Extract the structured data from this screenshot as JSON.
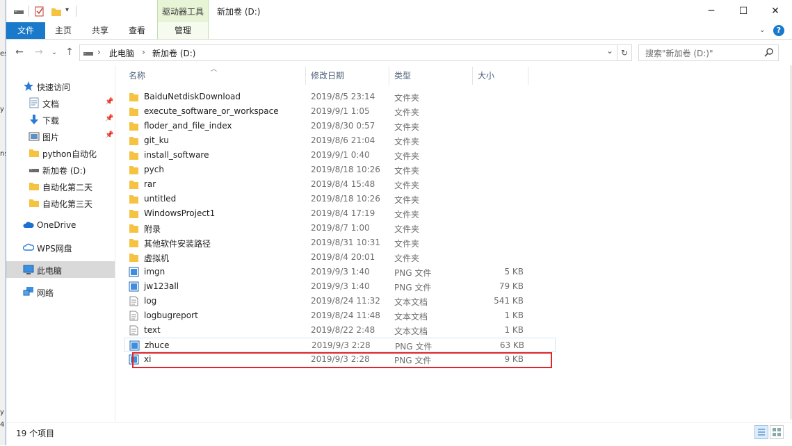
{
  "window": {
    "title": "新加卷 (D:)",
    "context_group": "驱动器工具",
    "controls": {
      "minimize": "─",
      "maximize": "☐",
      "close": "✕"
    }
  },
  "ribbon": {
    "tabs": [
      "文件",
      "主页",
      "共享",
      "查看",
      "管理"
    ],
    "help": "?"
  },
  "address": {
    "back": "←",
    "forward": "→",
    "up": "↑",
    "crumbs": [
      "此电脑",
      "新加卷 (D:)"
    ],
    "separator": "›",
    "dropdown": "⌄",
    "refresh": "↻"
  },
  "search": {
    "placeholder": "搜索\"新加卷 (D:)\"",
    "icon": "search-icon"
  },
  "sidebar": {
    "items": [
      {
        "label": "快速访问",
        "icon": "star-icon",
        "pinned": false
      },
      {
        "label": "文档",
        "icon": "document-icon",
        "pinned": true
      },
      {
        "label": "下载",
        "icon": "download-icon",
        "pinned": true
      },
      {
        "label": "图片",
        "icon": "picture-icon",
        "pinned": true
      },
      {
        "label": "python自动化",
        "icon": "folder-icon",
        "pinned": false
      },
      {
        "label": "新加卷 (D:)",
        "icon": "drive-icon",
        "pinned": false
      },
      {
        "label": "自动化第二天",
        "icon": "folder-icon",
        "pinned": false
      },
      {
        "label": "自动化第三天",
        "icon": "folder-icon",
        "pinned": false
      },
      {
        "label": "OneDrive",
        "icon": "cloud-icon",
        "pinned": false
      },
      {
        "label": "WPS网盘",
        "icon": "cloud-outline-icon",
        "pinned": false
      },
      {
        "label": "此电脑",
        "icon": "computer-icon",
        "pinned": false,
        "selected": true
      },
      {
        "label": "网络",
        "icon": "network-icon",
        "pinned": false
      }
    ]
  },
  "columns": {
    "name": "名称",
    "date": "修改日期",
    "type": "类型",
    "size": "大小"
  },
  "files": [
    {
      "name": "BaiduNetdiskDownload",
      "date": "2019/8/5 23:14",
      "type": "文件夹",
      "size": "",
      "kind": "folder"
    },
    {
      "name": "execute_software_or_workspace",
      "date": "2019/9/1 1:05",
      "type": "文件夹",
      "size": "",
      "kind": "folder"
    },
    {
      "name": "floder_and_file_index",
      "date": "2019/8/30 0:57",
      "type": "文件夹",
      "size": "",
      "kind": "folder"
    },
    {
      "name": "git_ku",
      "date": "2019/8/6 21:04",
      "type": "文件夹",
      "size": "",
      "kind": "folder"
    },
    {
      "name": "install_software",
      "date": "2019/9/1 0:40",
      "type": "文件夹",
      "size": "",
      "kind": "folder"
    },
    {
      "name": "pych",
      "date": "2019/8/18 10:26",
      "type": "文件夹",
      "size": "",
      "kind": "folder"
    },
    {
      "name": "rar",
      "date": "2019/8/4 15:48",
      "type": "文件夹",
      "size": "",
      "kind": "folder"
    },
    {
      "name": "untitled",
      "date": "2019/8/18 10:26",
      "type": "文件夹",
      "size": "",
      "kind": "folder"
    },
    {
      "name": "WindowsProject1",
      "date": "2019/8/4 17:19",
      "type": "文件夹",
      "size": "",
      "kind": "folder"
    },
    {
      "name": "附录",
      "date": "2019/8/7 1:00",
      "type": "文件夹",
      "size": "",
      "kind": "folder"
    },
    {
      "name": "其他软件安装路径",
      "date": "2019/8/31 10:31",
      "type": "文件夹",
      "size": "",
      "kind": "folder"
    },
    {
      "name": "虚拟机",
      "date": "2019/8/4 20:01",
      "type": "文件夹",
      "size": "",
      "kind": "folder"
    },
    {
      "name": "imgn",
      "date": "2019/9/3 1:40",
      "type": "PNG 文件",
      "size": "5 KB",
      "kind": "png"
    },
    {
      "name": "jw123all",
      "date": "2019/9/3 1:40",
      "type": "PNG 文件",
      "size": "79 KB",
      "kind": "png"
    },
    {
      "name": "log",
      "date": "2019/8/24 11:32",
      "type": "文本文档",
      "size": "541 KB",
      "kind": "txt"
    },
    {
      "name": "logbugreport",
      "date": "2019/8/24 11:48",
      "type": "文本文档",
      "size": "1 KB",
      "kind": "txt"
    },
    {
      "name": "text",
      "date": "2019/8/22 2:48",
      "type": "文本文档",
      "size": "1 KB",
      "kind": "txt"
    },
    {
      "name": "zhuce",
      "date": "2019/9/3 2:28",
      "type": "PNG 文件",
      "size": "63 KB",
      "kind": "png",
      "hovered": true
    },
    {
      "name": "xi",
      "date": "2019/9/3 2:28",
      "type": "PNG 文件",
      "size": "9 KB",
      "kind": "png",
      "highlighted": true
    }
  ],
  "status": {
    "count": "19 个项目"
  },
  "colors": {
    "accent": "#1979ca",
    "folder": "#f5c242",
    "highlight": "#e0262b",
    "context_tab": "#e8f4d6"
  }
}
